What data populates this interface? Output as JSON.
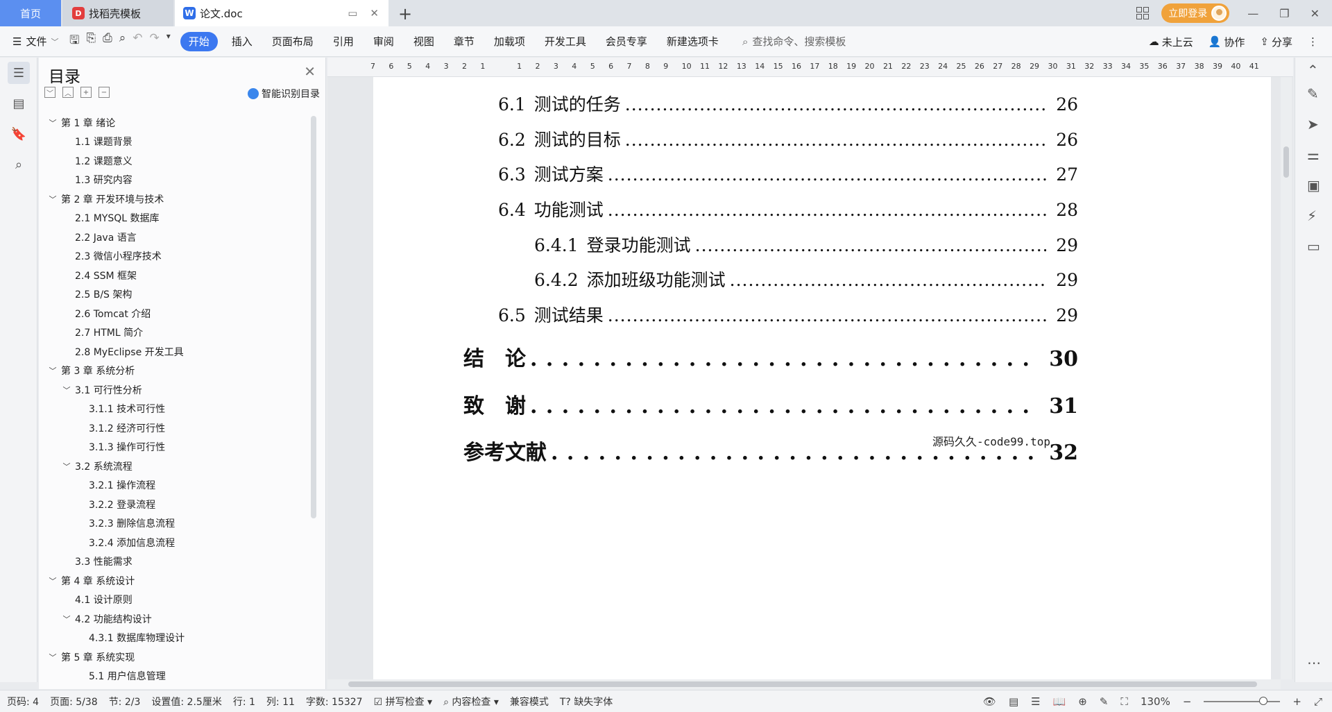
{
  "titlebar": {
    "tabs": [
      {
        "label": "首页"
      },
      {
        "label": "找稻壳模板"
      },
      {
        "label": "论文.doc"
      }
    ],
    "login_label": "立即登录"
  },
  "toolbar": {
    "file_label": "文件",
    "menu": [
      "开始",
      "插入",
      "页面布局",
      "引用",
      "审阅",
      "视图",
      "章节",
      "加载项",
      "开发工具",
      "会员专享",
      "新建选项卡"
    ],
    "search_placeholder": "查找命令、搜索模板",
    "cloud_label": "未上云",
    "collab_label": "协作",
    "share_label": "分享"
  },
  "toc_panel": {
    "title": "目录",
    "smart_label": "智能识别目录",
    "items": [
      {
        "level": 1,
        "caret": "﹀",
        "label": "第 1 章  绪论"
      },
      {
        "level": 2,
        "caret": "",
        "label": "1.1  课题背景"
      },
      {
        "level": 2,
        "caret": "",
        "label": "1.2  课题意义"
      },
      {
        "level": 2,
        "caret": "",
        "label": "1.3  研究内容"
      },
      {
        "level": 1,
        "caret": "﹀",
        "label": "第 2 章  开发环境与技术"
      },
      {
        "level": 2,
        "caret": "",
        "label": "2.1  MYSQL 数据库"
      },
      {
        "level": 2,
        "caret": "",
        "label": "2.2 Java 语言"
      },
      {
        "level": 2,
        "caret": "",
        "label": "2.3  微信小程序技术"
      },
      {
        "level": 2,
        "caret": "",
        "label": "2.4 SSM 框架"
      },
      {
        "level": 2,
        "caret": "",
        "label": "2.5 B/S 架构"
      },
      {
        "level": 2,
        "caret": "",
        "label": "2.6 Tomcat  介绍"
      },
      {
        "level": 2,
        "caret": "",
        "label": "2.7 HTML 简介"
      },
      {
        "level": 2,
        "caret": "",
        "label": "2.8 MyEclipse 开发工具"
      },
      {
        "level": 1,
        "caret": "﹀",
        "label": "第 3 章  系统分析"
      },
      {
        "level": 2,
        "caret": "﹀",
        "label": "3.1  可行性分析"
      },
      {
        "level": 3,
        "caret": "",
        "label": "3.1.1  技术可行性"
      },
      {
        "level": 3,
        "caret": "",
        "label": "3.1.2  经济可行性"
      },
      {
        "level": 3,
        "caret": "",
        "label": "3.1.3  操作可行性"
      },
      {
        "level": 2,
        "caret": "﹀",
        "label": "3.2  系统流程"
      },
      {
        "level": 3,
        "caret": "",
        "label": "3.2.1  操作流程"
      },
      {
        "level": 3,
        "caret": "",
        "label": "3.2.2  登录流程"
      },
      {
        "level": 3,
        "caret": "",
        "label": "3.2.3  删除信息流程"
      },
      {
        "level": 3,
        "caret": "",
        "label": "3.2.4  添加信息流程"
      },
      {
        "level": 2,
        "caret": "",
        "label": "3.3  性能需求"
      },
      {
        "level": 1,
        "caret": "﹀",
        "label": "第 4 章  系统设计"
      },
      {
        "level": 2,
        "caret": "",
        "label": "4.1  设计原则"
      },
      {
        "level": 2,
        "caret": "﹀",
        "label": "4.2  功能结构设计"
      },
      {
        "level": 3,
        "caret": "",
        "label": "4.3.1  数据库物理设计"
      },
      {
        "level": 1,
        "caret": "﹀",
        "label": "第 5 章  系统实现"
      },
      {
        "level": 3,
        "caret": "",
        "label": "5.1 用户信息管理"
      }
    ]
  },
  "ruler": {
    "numbers": [
      "7",
      "6",
      "5",
      "4",
      "3",
      "2",
      "1",
      "",
      "1",
      "2",
      "3",
      "4",
      "5",
      "6",
      "7",
      "8",
      "9",
      "10",
      "11",
      "12",
      "13",
      "14",
      "15",
      "16",
      "17",
      "18",
      "19",
      "20",
      "21",
      "22",
      "23",
      "24",
      "25",
      "26",
      "27",
      "28",
      "29",
      "30",
      "31",
      "32",
      "33",
      "34",
      "35",
      "36",
      "37",
      "38",
      "39",
      "40",
      "41"
    ]
  },
  "document": {
    "entries": [
      {
        "num": "6.1",
        "title": "测试的任务",
        "page": "26"
      },
      {
        "num": "6.2",
        "title": "测试的目标",
        "page": "26"
      },
      {
        "num": "6.3",
        "title": "测试方案",
        "page": "27"
      },
      {
        "num": "6.4",
        "title": "功能测试",
        "page": "28"
      },
      {
        "num": "6.4.1",
        "title": "登录功能测试",
        "page": "29"
      },
      {
        "num": "6.4.2",
        "title": "添加班级功能测试",
        "page": "29"
      },
      {
        "num": "6.5",
        "title": "测试结果",
        "page": "29"
      },
      {
        "num": "",
        "title": "结　论",
        "page": "30"
      },
      {
        "num": "",
        "title": "致　谢",
        "page": "31"
      },
      {
        "num": "",
        "title": "参考文献",
        "page": "32"
      }
    ],
    "watermark": "源码久久-code99.top"
  },
  "statusbar": {
    "page_code": "页码: 4",
    "page": "页面: 5/38",
    "section": "节: 2/3",
    "setting": "设置值: 2.5厘米",
    "row": "行: 1",
    "col": "列: 11",
    "words": "字数: 15327",
    "spell": "拼写检查",
    "content_check": "内容检查",
    "compat": "兼容模式",
    "missing_font": "缺失字体",
    "zoom": "130%"
  }
}
